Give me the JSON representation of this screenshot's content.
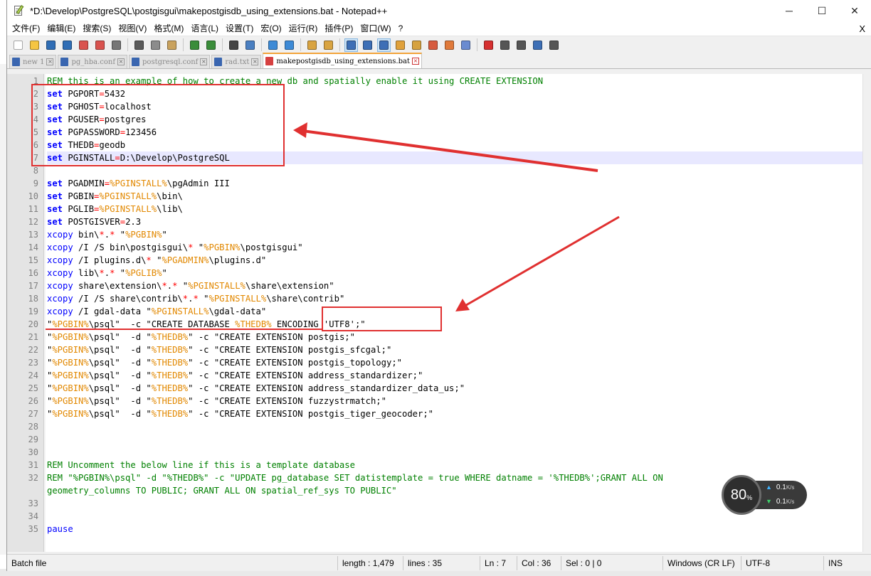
{
  "window": {
    "title": "*D:\\Develop\\PostgreSQL\\postgisgui\\makepostgisdb_using_extensions.bat - Notepad++",
    "minimize": "─",
    "maximize": "☐",
    "close": "✕"
  },
  "menu": {
    "items": [
      "文件(F)",
      "编辑(E)",
      "搜索(S)",
      "视图(V)",
      "格式(M)",
      "语言(L)",
      "设置(T)",
      "宏(O)",
      "运行(R)",
      "插件(P)",
      "窗口(W)",
      "?"
    ],
    "close_doc": "X"
  },
  "toolbar": {
    "buttons": [
      {
        "icon": "new-file-icon",
        "color": "#ffffff"
      },
      {
        "icon": "open-file-icon",
        "color": "#f5c542"
      },
      {
        "icon": "save-icon",
        "color": "#2f6db5"
      },
      {
        "icon": "save-all-icon",
        "color": "#2f6db5"
      },
      {
        "icon": "close-icon",
        "color": "#d9534f"
      },
      {
        "icon": "close-all-icon",
        "color": "#d9534f"
      },
      {
        "icon": "print-icon",
        "color": "#777777"
      },
      {
        "sep": true
      },
      {
        "icon": "cut-icon",
        "color": "#5a5a5a"
      },
      {
        "icon": "copy-icon",
        "color": "#8c8c8c"
      },
      {
        "icon": "paste-icon",
        "color": "#c9a25e"
      },
      {
        "sep": true
      },
      {
        "icon": "undo-icon",
        "color": "#3a8d3a"
      },
      {
        "icon": "redo-icon",
        "color": "#3a8d3a"
      },
      {
        "sep": true
      },
      {
        "icon": "find-icon",
        "color": "#444444"
      },
      {
        "icon": "replace-icon",
        "color": "#4a7fc1"
      },
      {
        "sep": true
      },
      {
        "icon": "zoom-in-icon",
        "color": "#3d8ad6"
      },
      {
        "icon": "zoom-out-icon",
        "color": "#3d8ad6"
      },
      {
        "sep": true
      },
      {
        "icon": "sync-vertical-icon",
        "color": "#d9a441"
      },
      {
        "icon": "sync-horizontal-icon",
        "color": "#d9a441"
      },
      {
        "sep": true
      },
      {
        "icon": "word-wrap-icon",
        "color": "#3d6fb6",
        "active": true
      },
      {
        "icon": "show-all-chars-icon",
        "color": "#3d6fb6"
      },
      {
        "icon": "indent-guide-icon",
        "color": "#3d6fb6",
        "active": true
      },
      {
        "icon": "lang-define-icon",
        "color": "#e0a13b"
      },
      {
        "icon": "doc-map-icon",
        "color": "#d6a23f"
      },
      {
        "icon": "function-list-icon",
        "color": "#d65b3f"
      },
      {
        "icon": "folder-workspace-icon",
        "color": "#e07a3b"
      },
      {
        "icon": "monitoring-icon",
        "color": "#6a8bd0"
      },
      {
        "sep": true
      },
      {
        "icon": "record-macro-icon",
        "color": "#d63030"
      },
      {
        "icon": "stop-record-icon",
        "color": "#555555"
      },
      {
        "icon": "play-macro-icon",
        "color": "#555555"
      },
      {
        "icon": "play-multiple-icon",
        "color": "#3d6fb6"
      },
      {
        "icon": "save-macro-icon",
        "color": "#555555"
      }
    ]
  },
  "tabs": [
    {
      "label": "new 1",
      "icon_color": "#3a66b0",
      "active": false
    },
    {
      "label": "pg_hba.conf",
      "icon_color": "#3a66b0",
      "active": false
    },
    {
      "label": "postgresql.conf",
      "icon_color": "#3a66b0",
      "active": false
    },
    {
      "label": "rad.txt",
      "icon_color": "#3a66b0",
      "active": false
    },
    {
      "label": "makepostgisdb_using_extensions.bat",
      "icon_color": "#d64040",
      "active": true
    }
  ],
  "editor": {
    "current_line": 7,
    "line_numbers": [
      "1",
      "2",
      "3",
      "4",
      "5",
      "6",
      "7",
      "8",
      "9",
      "10",
      "11",
      "12",
      "13",
      "14",
      "15",
      "16",
      "17",
      "18",
      "19",
      "20",
      "21",
      "22",
      "23",
      "24",
      "25",
      "26",
      "27",
      "28",
      "29",
      "30",
      "31",
      "32",
      "",
      "33",
      "34",
      "35"
    ],
    "lines": [
      [
        [
          "rem",
          "REM this is an example of how to create a new db and spatially enable it using CREATE EXTENSION"
        ]
      ],
      [
        [
          "k",
          "set"
        ],
        [
          "s",
          " PGPORT"
        ],
        [
          "op",
          "="
        ],
        [
          "s",
          "5432"
        ]
      ],
      [
        [
          "k",
          "set"
        ],
        [
          "s",
          " PGHOST"
        ],
        [
          "op",
          "="
        ],
        [
          "s",
          "localhost"
        ]
      ],
      [
        [
          "k",
          "set"
        ],
        [
          "s",
          " PGUSER"
        ],
        [
          "op",
          "="
        ],
        [
          "s",
          "postgres"
        ]
      ],
      [
        [
          "k",
          "set"
        ],
        [
          "s",
          " PGPASSWORD"
        ],
        [
          "op",
          "="
        ],
        [
          "s",
          "123456"
        ]
      ],
      [
        [
          "k",
          "set"
        ],
        [
          "s",
          " THEDB"
        ],
        [
          "op",
          "="
        ],
        [
          "s",
          "geodb"
        ]
      ],
      [
        [
          "k",
          "set"
        ],
        [
          "s",
          " PGINSTALL"
        ],
        [
          "op",
          "="
        ],
        [
          "s",
          "D:\\Develop\\PostgreSQL"
        ]
      ],
      [],
      [
        [
          "k",
          "set"
        ],
        [
          "s",
          " PGADMIN"
        ],
        [
          "op",
          "="
        ],
        [
          "v",
          "%PGINSTALL%"
        ],
        [
          "s",
          "\\pgAdmin III"
        ]
      ],
      [
        [
          "k",
          "set"
        ],
        [
          "s",
          " PGBIN"
        ],
        [
          "op",
          "="
        ],
        [
          "v",
          "%PGINSTALL%"
        ],
        [
          "s",
          "\\bin\\"
        ]
      ],
      [
        [
          "k",
          "set"
        ],
        [
          "s",
          " PGLIB"
        ],
        [
          "op",
          "="
        ],
        [
          "v",
          "%PGINSTALL%"
        ],
        [
          "s",
          "\\lib\\"
        ]
      ],
      [
        [
          "k",
          "set"
        ],
        [
          "s",
          " POSTGISVER"
        ],
        [
          "op",
          "="
        ],
        [
          "s",
          "2.3"
        ]
      ],
      [
        [
          "k2",
          "xcopy"
        ],
        [
          "s",
          " bin\\"
        ],
        [
          "op",
          "*"
        ],
        [
          "s",
          "."
        ],
        [
          "op",
          "*"
        ],
        [
          "s",
          " \""
        ],
        [
          "v",
          "%PGBIN%"
        ],
        [
          "s",
          "\""
        ]
      ],
      [
        [
          "k2",
          "xcopy"
        ],
        [
          "s",
          " /I /S bin\\postgisgui\\"
        ],
        [
          "op",
          "*"
        ],
        [
          "s",
          " \""
        ],
        [
          "v",
          "%PGBIN%"
        ],
        [
          "s",
          "\\postgisgui\""
        ]
      ],
      [
        [
          "k2",
          "xcopy"
        ],
        [
          "s",
          " /I plugins.d\\"
        ],
        [
          "op",
          "*"
        ],
        [
          "s",
          " \""
        ],
        [
          "v",
          "%PGADMIN%"
        ],
        [
          "s",
          "\\plugins.d\""
        ]
      ],
      [
        [
          "k2",
          "xcopy"
        ],
        [
          "s",
          " lib\\"
        ],
        [
          "op",
          "*"
        ],
        [
          "s",
          "."
        ],
        [
          "op",
          "*"
        ],
        [
          "s",
          " \""
        ],
        [
          "v",
          "%PGLIB%"
        ],
        [
          "s",
          "\""
        ]
      ],
      [
        [
          "k2",
          "xcopy"
        ],
        [
          "s",
          " share\\extension\\"
        ],
        [
          "op",
          "*"
        ],
        [
          "s",
          "."
        ],
        [
          "op",
          "*"
        ],
        [
          "s",
          " \""
        ],
        [
          "v",
          "%PGINSTALL%"
        ],
        [
          "s",
          "\\share\\extension\""
        ]
      ],
      [
        [
          "k2",
          "xcopy"
        ],
        [
          "s",
          " /I /S share\\contrib\\"
        ],
        [
          "op",
          "*"
        ],
        [
          "s",
          "."
        ],
        [
          "op",
          "*"
        ],
        [
          "s",
          " \""
        ],
        [
          "v",
          "%PGINSTALL%"
        ],
        [
          "s",
          "\\share\\contrib\""
        ]
      ],
      [
        [
          "k2",
          "xcopy"
        ],
        [
          "s",
          " /I gdal-data \""
        ],
        [
          "v",
          "%PGINSTALL%"
        ],
        [
          "s",
          "\\gdal-data\""
        ]
      ],
      [
        [
          "s",
          "\""
        ],
        [
          "v",
          "%PGBIN%"
        ],
        [
          "s",
          "\\psql\"  -c \"CREATE DATABASE "
        ],
        [
          "v",
          "%THEDB%"
        ],
        [
          "s",
          " ENCODING 'UTF8';\""
        ]
      ],
      [
        [
          "s",
          "\""
        ],
        [
          "v",
          "%PGBIN%"
        ],
        [
          "s",
          "\\psql\"  -d \""
        ],
        [
          "v",
          "%THEDB%"
        ],
        [
          "s",
          "\" -c \"CREATE EXTENSION postgis;\""
        ]
      ],
      [
        [
          "s",
          "\""
        ],
        [
          "v",
          "%PGBIN%"
        ],
        [
          "s",
          "\\psql\"  -d \""
        ],
        [
          "v",
          "%THEDB%"
        ],
        [
          "s",
          "\" -c \"CREATE EXTENSION postgis_sfcgal;\""
        ]
      ],
      [
        [
          "s",
          "\""
        ],
        [
          "v",
          "%PGBIN%"
        ],
        [
          "s",
          "\\psql\"  -d \""
        ],
        [
          "v",
          "%THEDB%"
        ],
        [
          "s",
          "\" -c \"CREATE EXTENSION postgis_topology;\""
        ]
      ],
      [
        [
          "s",
          "\""
        ],
        [
          "v",
          "%PGBIN%"
        ],
        [
          "s",
          "\\psql\"  -d \""
        ],
        [
          "v",
          "%THEDB%"
        ],
        [
          "s",
          "\" -c \"CREATE EXTENSION address_standardizer;\""
        ]
      ],
      [
        [
          "s",
          "\""
        ],
        [
          "v",
          "%PGBIN%"
        ],
        [
          "s",
          "\\psql\"  -d \""
        ],
        [
          "v",
          "%THEDB%"
        ],
        [
          "s",
          "\" -c \"CREATE EXTENSION address_standardizer_data_us;\""
        ]
      ],
      [
        [
          "s",
          "\""
        ],
        [
          "v",
          "%PGBIN%"
        ],
        [
          "s",
          "\\psql\"  -d \""
        ],
        [
          "v",
          "%THEDB%"
        ],
        [
          "s",
          "\" -c \"CREATE EXTENSION fuzzystrmatch;\""
        ]
      ],
      [
        [
          "s",
          "\""
        ],
        [
          "v",
          "%PGBIN%"
        ],
        [
          "s",
          "\\psql\"  -d \""
        ],
        [
          "v",
          "%THEDB%"
        ],
        [
          "s",
          "\" -c \"CREATE EXTENSION postgis_tiger_geocoder;\""
        ]
      ],
      [],
      [],
      [],
      [
        [
          "rem",
          "REM Uncomment the below line if this is a template database"
        ]
      ],
      [
        [
          "rem",
          "REM \"%PGBIN%\\psql\" -d \"%THEDB%\" -c \"UPDATE pg_database SET datistemplate = true WHERE datname = '%THEDB%';GRANT ALL ON"
        ]
      ],
      [
        [
          "rem",
          "geometry_columns TO PUBLIC; GRANT ALL ON spatial_ref_sys TO PUBLIC\""
        ]
      ],
      [],
      [],
      [
        [
          "k2",
          "pause"
        ]
      ]
    ]
  },
  "status": {
    "file_type": "Batch file",
    "length": "length : 1,479",
    "lines": "lines : 35",
    "ln": "Ln : 7",
    "col": "Col : 36",
    "sel": "Sel : 0 | 0",
    "eol": "Windows (CR LF)",
    "encoding": "UTF-8",
    "insert_mode": "INS"
  },
  "net_widget": {
    "percent": "80",
    "percent_sign": "%",
    "up_rate": "0.1",
    "down_rate": "0.1",
    "unit": "K/s"
  },
  "annotation_color": "#e03030"
}
